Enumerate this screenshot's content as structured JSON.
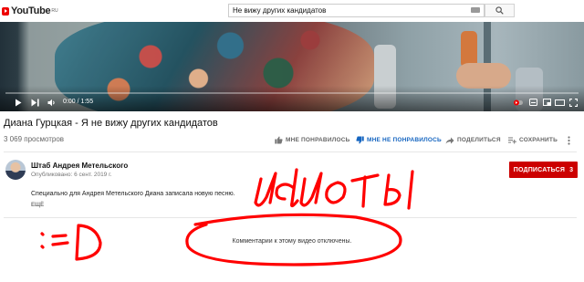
{
  "header": {
    "logo_text": "YouTube",
    "logo_region": "RU",
    "search_value": "Не вижу других кандидатов"
  },
  "player": {
    "time_display": "0:00 / 1:55",
    "progress_fraction": 0.0
  },
  "video": {
    "title": "Диана Гурцкая - Я не вижу других кандидатов",
    "views": "3 069 просмотров",
    "actions": {
      "like": "МНЕ ПОНРАВИЛОСЬ",
      "dislike": "МНЕ НЕ ПОНРАВИЛОСЬ",
      "share": "ПОДЕЛИТЬСЯ",
      "save": "СОХРАНИТЬ"
    }
  },
  "channel": {
    "name": "Штаб Андрея Метельского",
    "published": "Опубликовано: 6 сент. 2019 г.",
    "subscribe_label": "ПОДПИСАТЬСЯ",
    "subscriber_count": "3",
    "description": "Специально для Андрея Метельского Диана записала новую песню.",
    "more_label": "ЕЩЁ"
  },
  "comments": {
    "disabled_message": "Комментарии к этому видео отключены."
  },
  "handwriting": {
    "word": "идиоты",
    "emoticon": ":=D"
  },
  "colors": {
    "brand_red": "#cc0000",
    "progress_red": "#ff0000",
    "link_blue": "#1565c0",
    "scribble_red": "#ff0000"
  }
}
